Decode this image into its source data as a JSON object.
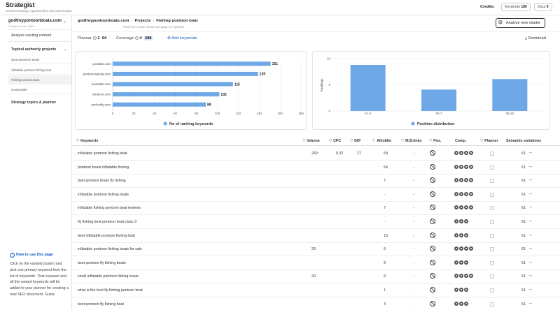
{
  "app": {
    "title": "Strategist",
    "subtitle": "Content strategy, opportunities and optimization",
    "credits_label": "Credits:",
    "keywords_label": "Keywords",
    "keywords_count": "189",
    "docs_label": "Docs",
    "docs_count": "0"
  },
  "sidebar": {
    "domain": "godfreypontoonboats.com",
    "domain_sub": "Position found: 100%",
    "analyze_existing": "Analyze existing content",
    "topical_projects": "Topical authority projects",
    "projects": [
      "speed pontoon boats",
      "inflatable pontoon fishing boat",
      "Fishing pontoon boat",
      "snowmobile"
    ],
    "strategy_topics": "Strategy topics & planner",
    "howto_title": "How to use this page",
    "howto_text": "Click on the variant(cluster) and pick one primary keyword from the list of keywords. That keyword and all the variant keywords will be added to your planner for creating a new SEO document. Guide"
  },
  "header": {
    "breadcrumb": [
      "godfreypontoonboats.com",
      "Projects",
      "Fishing pontoon boat"
    ],
    "subtitle": "Find new content ideas and pages to optimize",
    "analyze_button": "Analyze new cluster",
    "planner_label": "Planner",
    "planner_a": "2",
    "planner_b": "64",
    "coverage_label": "Coverage",
    "coverage_a": "4",
    "coverage_b": "288",
    "add_keywords": "Add keywords",
    "download": "Download"
  },
  "chart_data": [
    {
      "type": "bar",
      "orientation": "horizontal",
      "categories": [
        "youtube.com",
        "pontoonopedia.com",
        "boatsafe.com",
        "amazon.com",
        "anchorfly.com"
      ],
      "values": [
        151,
        139,
        115,
        102,
        89
      ],
      "xlim": [
        0,
        180
      ],
      "xticks": [
        0,
        20,
        40,
        60,
        80,
        100,
        120,
        140,
        160,
        180
      ],
      "legend": "No of ranking keywords",
      "color": "#6ea8e6"
    },
    {
      "type": "bar",
      "categories": [
        "#1-3",
        "#4-7",
        "#8-10"
      ],
      "values": [
        8.8,
        4.1,
        6.1
      ],
      "ylim": [
        0,
        10
      ],
      "yticks": [
        0,
        5,
        10
      ],
      "ylabel": "Rankings",
      "legend": "Position distribution",
      "color": "#6ea8e6"
    }
  ],
  "table": {
    "headers": {
      "keywords": "Keywords",
      "volume": "Volume",
      "cpc": "CPC",
      "diff": "Diff",
      "allintitle": "Allintitle",
      "mb_links": "M.B.links",
      "pos": "Pos.",
      "comp": "Comp.",
      "planner": "Planner",
      "semantic": "Semantic variations"
    },
    "rows": [
      {
        "kw": "inflatable pontoon fishing boat",
        "volume": "260",
        "cpc": "0.32",
        "diff": "27",
        "allintitle": "59",
        "mb": "-",
        "dots": 4,
        "sem": "61"
      },
      {
        "kw": "pontoon boats inflatable fishing",
        "volume": "",
        "cpc": "",
        "diff": "",
        "allintitle": "54",
        "mb": "-",
        "dots": 4,
        "sem": "61"
      },
      {
        "kw": "best pontoon boats fly fishing",
        "volume": "",
        "cpc": "",
        "diff": "",
        "allintitle": "7",
        "mb": "-",
        "dots": 4,
        "sem": "61"
      },
      {
        "kw": "inflatable pontoon fishing boats",
        "volume": "",
        "cpc": "",
        "diff": "",
        "allintitle": "-",
        "mb": "-",
        "dots": 4,
        "sem": "61"
      },
      {
        "kw": "inflatable fishing pontoon boat reviews",
        "volume": "",
        "cpc": "",
        "diff": "",
        "allintitle": "7",
        "mb": "-",
        "dots": 4,
        "sem": "61"
      },
      {
        "kw": "fly fishing best pontoon boat class 3",
        "volume": "",
        "cpc": "",
        "diff": "",
        "allintitle": "-",
        "mb": "-",
        "dots": 3,
        "sem": "61"
      },
      {
        "kw": "best inflatable pontoon fishing boat",
        "volume": "",
        "cpc": "",
        "diff": "",
        "allintitle": "10",
        "mb": "-",
        "dots": 3,
        "sem": "61"
      },
      {
        "kw": "inflatable pontoon fishing boats for sale",
        "volume": "20",
        "cpc": "",
        "diff": "",
        "allintitle": "9",
        "mb": "-",
        "dots": 4,
        "sem": "61"
      },
      {
        "kw": "best pontoon fly fishing boats",
        "volume": "",
        "cpc": "",
        "diff": "",
        "allintitle": "9",
        "mb": "-",
        "dots": 3,
        "sem": "61"
      },
      {
        "kw": "small inflatable pontoon fishing boats",
        "volume": "20",
        "cpc": "",
        "diff": "",
        "allintitle": "9",
        "mb": "-",
        "dots": 4,
        "sem": "61"
      },
      {
        "kw": "what is the best fly fishing pontoon boat",
        "volume": "",
        "cpc": "",
        "diff": "",
        "allintitle": "1",
        "mb": "-",
        "dots": 3,
        "sem": "61"
      },
      {
        "kw": "best pontoon fly fishing boat",
        "volume": "",
        "cpc": "",
        "diff": "",
        "allintitle": "3",
        "mb": "-",
        "dots": 3,
        "sem": "61"
      }
    ]
  }
}
